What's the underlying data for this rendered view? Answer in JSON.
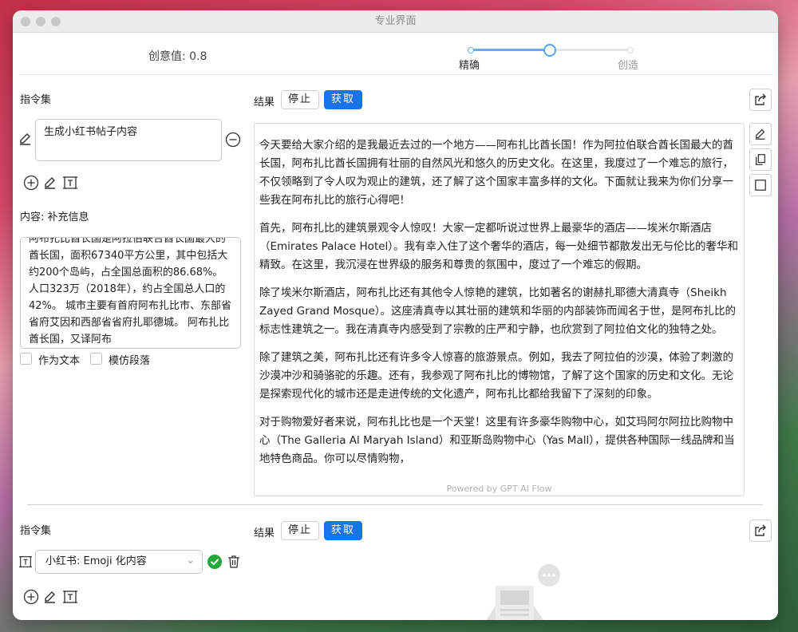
{
  "window": {
    "title": "专业界面"
  },
  "creativity": {
    "label": "创意值: 0.8",
    "value": 0.8,
    "left_label": "精确",
    "right_label": "创造"
  },
  "panel1": {
    "instructions_label": "指令集",
    "instruction_text": "生成小红书帖子内容",
    "content_label": "内容: 补充信息",
    "content_text": "阿布扎比酋长国是阿拉伯联合酋长国最大的酋长国，面积67340平方公里，其中包括大约200个岛屿，占全国总面积的86.68%。人口323万（2018年），约占全国总人口的42%。 城市主要有首府阿布扎比市、东部省省府艾因和西部省省府扎耶德城。 阿布扎比酋长国，又译阿布",
    "checkbox_text": "作为文本",
    "checkbox_mimic": "模仿段落",
    "result_label": "结果",
    "stop_label": "停止",
    "fetch_label": "获取",
    "paragraphs": [
      "今天要给大家介绍的是我最近去过的一个地方——阿布扎比酋长国！作为阿拉伯联合酋长国最大的酋长国，阿布扎比酋长国拥有壮丽的自然风光和悠久的历史文化。在这里，我度过了一个难忘的旅行，不仅领略到了令人叹为观止的建筑，还了解了这个国家丰富多样的文化。下面就让我来为你们分享一些我在阿布扎比的旅行心得吧！",
      "首先，阿布扎比的建筑景观令人惊叹！大家一定都听说过世界上最豪华的酒店——埃米尔斯酒店（Emirates Palace Hotel）。我有幸入住了这个奢华的酒店，每一处细节都散发出无与伦比的奢华和精致。在这里，我沉浸在世界级的服务和尊贵的氛围中，度过了一个难忘的假期。",
      "除了埃米尔斯酒店，阿布扎比还有其他令人惊艳的建筑，比如著名的谢赫扎耶德大清真寺（Sheikh Zayed Grand Mosque）。这座清真寺以其壮丽的建筑和华丽的内部装饰而闻名于世，是阿布扎比的标志性建筑之一。我在清真寺内感受到了宗教的庄严和宁静，也欣赏到了阿拉伯文化的独特之处。",
      "除了建筑之美，阿布扎比还有许多令人惊喜的旅游景点。例如，我去了阿拉伯的沙漠，体验了刺激的沙漠冲沙和骑骆驼的乐趣。还有，我参观了阿布扎比的博物馆，了解了这个国家的历史和文化。无论是探索现代化的城市还是走进传统的文化遗产，阿布扎比都给我留下了深刻的印象。",
      "对于购物爱好者来说，阿布扎比也是一个天堂！这里有许多豪华购物中心，如艾玛阿尔阿拉比购物中心（The Galleria Al Maryah Island）和亚斯岛购物中心（Yas Mall），提供各种国际一线品牌和当地特色商品。你可以尽情购物，"
    ],
    "powered_by": "Powered by GPT AI Flow"
  },
  "panel2": {
    "instructions_label": "指令集",
    "selected_instruction": "小红书: Emoji 化内容",
    "result_label": "结果",
    "stop_label": "停止",
    "fetch_label": "获取"
  },
  "colors": {
    "accent": "#1a73e8",
    "success": "#22a83a"
  }
}
